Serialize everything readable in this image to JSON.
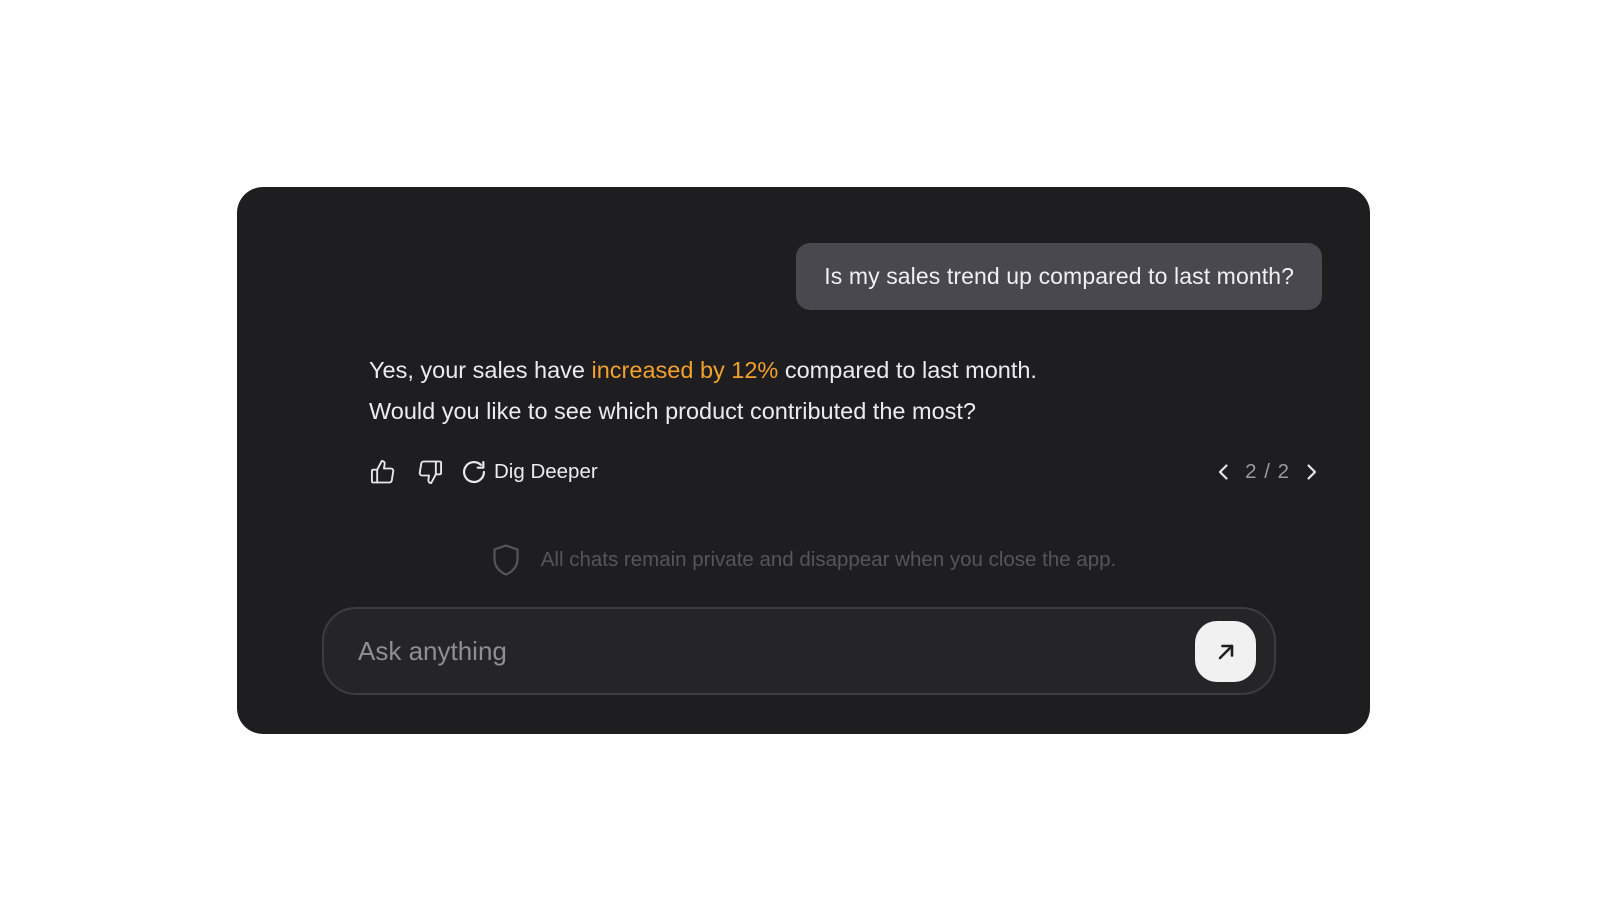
{
  "user_message": {
    "text": "Is my sales trend up compared to last month?"
  },
  "assistant_message": {
    "prefix": "Yes, your sales have ",
    "highlight": "increased by 12%",
    "suffix": " compared to last month.",
    "line2": "Would you like to see which product contributed the most?"
  },
  "actions": {
    "like_icon": "thumbs-up-icon",
    "dislike_icon": "thumbs-down-icon",
    "regenerate_icon": "refresh-icon",
    "dig_deeper_label": "Dig Deeper"
  },
  "pager": {
    "current": "2",
    "separator": "/",
    "total": "2",
    "prev_icon": "chevron-left-icon",
    "next_icon": "chevron-right-icon"
  },
  "privacy_note": {
    "icon": "shield-icon",
    "text": "All chats remain private and disappear when you close the app."
  },
  "composer": {
    "placeholder": "Ask anything",
    "value": "",
    "send_icon": "arrow-up-right-icon"
  },
  "colors": {
    "window_bg": "#1e1e20",
    "bubble_bg": "#48484e",
    "highlight": "#f2a12a",
    "input_bg": "#252528",
    "send_button_bg": "#f1f1f2"
  }
}
